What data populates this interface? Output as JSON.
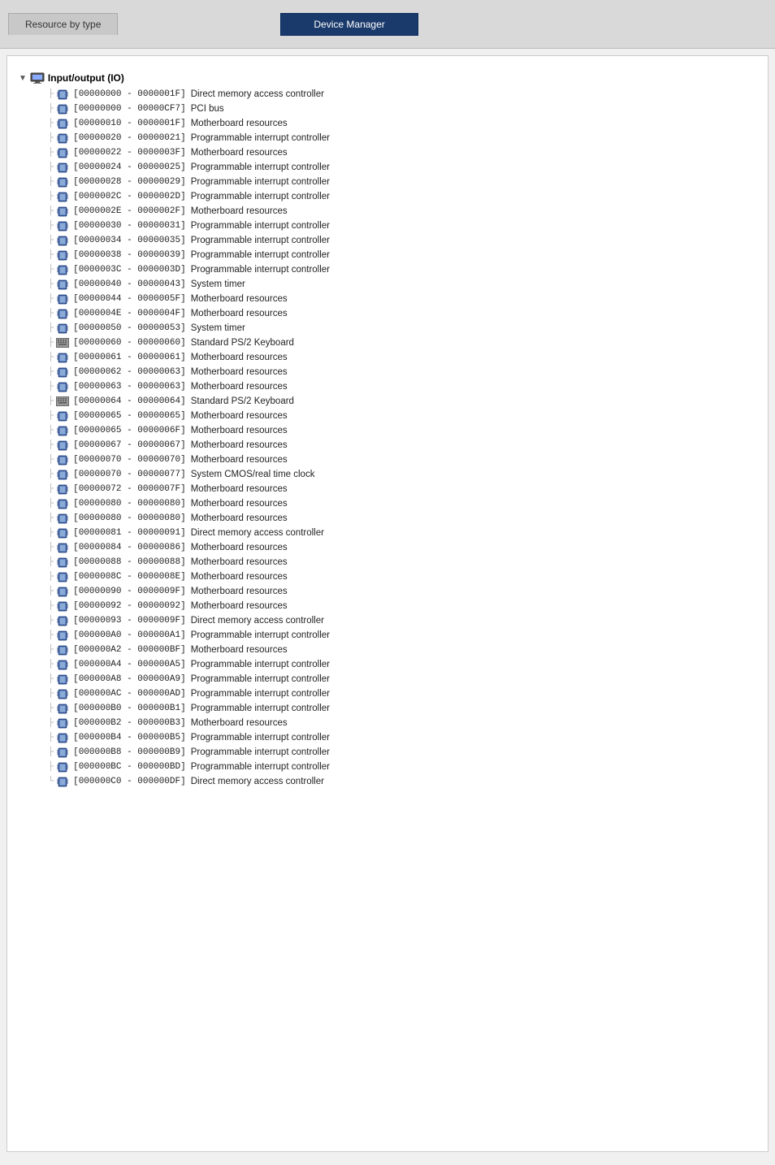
{
  "header": {
    "tab_left": "Resource by type",
    "tab_right": "Device Manager"
  },
  "tree": {
    "root_label": "Input/output (IO)",
    "items": [
      {
        "address": "[00000000 - 0000001F]",
        "description": "Direct memory access controller",
        "icon": "chip"
      },
      {
        "address": "[00000000 - 00000CF7]",
        "description": "PCI bus",
        "icon": "chip"
      },
      {
        "address": "[00000010 - 0000001F]",
        "description": "Motherboard resources",
        "icon": "chip"
      },
      {
        "address": "[00000020 - 00000021]",
        "description": "Programmable interrupt controller",
        "icon": "chip"
      },
      {
        "address": "[00000022 - 0000003F]",
        "description": "Motherboard resources",
        "icon": "chip"
      },
      {
        "address": "[00000024 - 00000025]",
        "description": "Programmable interrupt controller",
        "icon": "chip"
      },
      {
        "address": "[00000028 - 00000029]",
        "description": "Programmable interrupt controller",
        "icon": "chip"
      },
      {
        "address": "[0000002C - 0000002D]",
        "description": "Programmable interrupt controller",
        "icon": "chip"
      },
      {
        "address": "[0000002E - 0000002F]",
        "description": "Motherboard resources",
        "icon": "chip"
      },
      {
        "address": "[00000030 - 00000031]",
        "description": "Programmable interrupt controller",
        "icon": "chip"
      },
      {
        "address": "[00000034 - 00000035]",
        "description": "Programmable interrupt controller",
        "icon": "chip"
      },
      {
        "address": "[00000038 - 00000039]",
        "description": "Programmable interrupt controller",
        "icon": "chip"
      },
      {
        "address": "[0000003C - 0000003D]",
        "description": "Programmable interrupt controller",
        "icon": "chip"
      },
      {
        "address": "[00000040 - 00000043]",
        "description": "System timer",
        "icon": "chip"
      },
      {
        "address": "[00000044 - 0000005F]",
        "description": "Motherboard resources",
        "icon": "chip"
      },
      {
        "address": "[0000004E - 0000004F]",
        "description": "Motherboard resources",
        "icon": "chip"
      },
      {
        "address": "[00000050 - 00000053]",
        "description": "System timer",
        "icon": "chip"
      },
      {
        "address": "[00000060 - 00000060]",
        "description": "Standard PS/2 Keyboard",
        "icon": "keyboard"
      },
      {
        "address": "[00000061 - 00000061]",
        "description": "Motherboard resources",
        "icon": "chip"
      },
      {
        "address": "[00000062 - 00000063]",
        "description": "Motherboard resources",
        "icon": "chip"
      },
      {
        "address": "[00000063 - 00000063]",
        "description": "Motherboard resources",
        "icon": "chip"
      },
      {
        "address": "[00000064 - 00000064]",
        "description": "Standard PS/2 Keyboard",
        "icon": "keyboard"
      },
      {
        "address": "[00000065 - 00000065]",
        "description": "Motherboard resources",
        "icon": "chip"
      },
      {
        "address": "[00000065 - 0000006F]",
        "description": "Motherboard resources",
        "icon": "chip"
      },
      {
        "address": "[00000067 - 00000067]",
        "description": "Motherboard resources",
        "icon": "chip"
      },
      {
        "address": "[00000070 - 00000070]",
        "description": "Motherboard resources",
        "icon": "chip"
      },
      {
        "address": "[00000070 - 00000077]",
        "description": "System CMOS/real time clock",
        "icon": "chip"
      },
      {
        "address": "[00000072 - 0000007F]",
        "description": "Motherboard resources",
        "icon": "chip"
      },
      {
        "address": "[00000080 - 00000080]",
        "description": "Motherboard resources",
        "icon": "chip"
      },
      {
        "address": "[00000080 - 00000080]",
        "description": "Motherboard resources",
        "icon": "chip"
      },
      {
        "address": "[00000081 - 00000091]",
        "description": "Direct memory access controller",
        "icon": "chip"
      },
      {
        "address": "[00000084 - 00000086]",
        "description": "Motherboard resources",
        "icon": "chip"
      },
      {
        "address": "[00000088 - 00000088]",
        "description": "Motherboard resources",
        "icon": "chip"
      },
      {
        "address": "[0000008C - 0000008E]",
        "description": "Motherboard resources",
        "icon": "chip"
      },
      {
        "address": "[00000090 - 0000009F]",
        "description": "Motherboard resources",
        "icon": "chip"
      },
      {
        "address": "[00000092 - 00000092]",
        "description": "Motherboard resources",
        "icon": "chip"
      },
      {
        "address": "[00000093 - 0000009F]",
        "description": "Direct memory access controller",
        "icon": "chip"
      },
      {
        "address": "[000000A0 - 000000A1]",
        "description": "Programmable interrupt controller",
        "icon": "chip"
      },
      {
        "address": "[000000A2 - 000000BF]",
        "description": "Motherboard resources",
        "icon": "chip"
      },
      {
        "address": "[000000A4 - 000000A5]",
        "description": "Programmable interrupt controller",
        "icon": "chip"
      },
      {
        "address": "[000000A8 - 000000A9]",
        "description": "Programmable interrupt controller",
        "icon": "chip"
      },
      {
        "address": "[000000AC - 000000AD]",
        "description": "Programmable interrupt controller",
        "icon": "chip"
      },
      {
        "address": "[000000B0 - 000000B1]",
        "description": "Programmable interrupt controller",
        "icon": "chip"
      },
      {
        "address": "[000000B2 - 000000B3]",
        "description": "Motherboard resources",
        "icon": "chip"
      },
      {
        "address": "[000000B4 - 000000B5]",
        "description": "Programmable interrupt controller",
        "icon": "chip"
      },
      {
        "address": "[000000B8 - 000000B9]",
        "description": "Programmable interrupt controller",
        "icon": "chip"
      },
      {
        "address": "[000000BC - 000000BD]",
        "description": "Programmable interrupt controller",
        "icon": "chip"
      },
      {
        "address": "[000000C0 - 000000DF]",
        "description": "Direct memory access controller",
        "icon": "chip"
      }
    ]
  }
}
